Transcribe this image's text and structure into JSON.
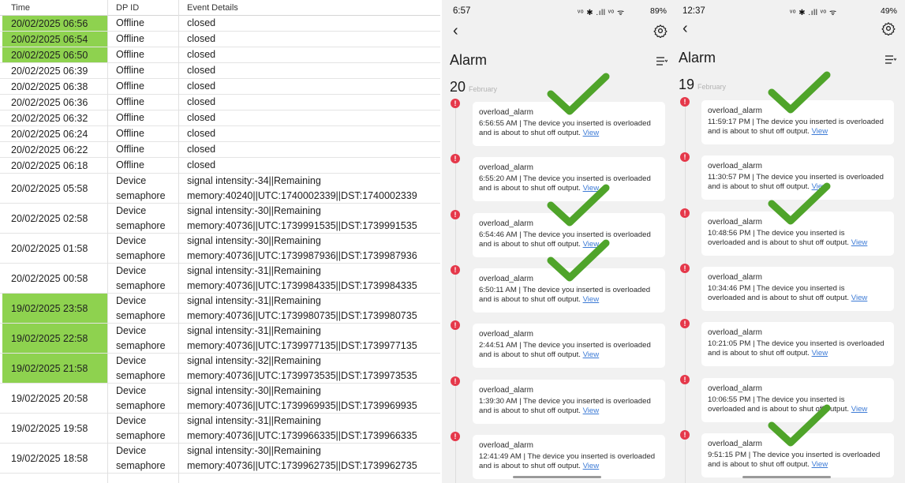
{
  "log": {
    "headers": [
      "Time",
      "DP ID",
      "Event Details"
    ],
    "rows": [
      {
        "time": "20/02/2025 06:56",
        "dp": "Offline",
        "ev1": "closed",
        "ev2": "",
        "hl": true
      },
      {
        "time": "20/02/2025 06:54",
        "dp": "Offline",
        "ev1": "closed",
        "ev2": "",
        "hl": true
      },
      {
        "time": "20/02/2025 06:50",
        "dp": "Offline",
        "ev1": "closed",
        "ev2": "",
        "hl": true
      },
      {
        "time": "20/02/2025 06:39",
        "dp": "Offline",
        "ev1": "closed",
        "ev2": "",
        "hl": false
      },
      {
        "time": "20/02/2025 06:38",
        "dp": "Offline",
        "ev1": "closed",
        "ev2": "",
        "hl": false
      },
      {
        "time": "20/02/2025 06:36",
        "dp": "Offline",
        "ev1": "closed",
        "ev2": "",
        "hl": false
      },
      {
        "time": "20/02/2025 06:32",
        "dp": "Offline",
        "ev1": "closed",
        "ev2": "",
        "hl": false
      },
      {
        "time": "20/02/2025 06:24",
        "dp": "Offline",
        "ev1": "closed",
        "ev2": "",
        "hl": false
      },
      {
        "time": "20/02/2025 06:22",
        "dp": "Offline",
        "ev1": "closed",
        "ev2": "",
        "hl": false
      },
      {
        "time": "20/02/2025 06:18",
        "dp": "Offline",
        "ev1": "closed",
        "ev2": "",
        "hl": false
      },
      {
        "time": "20/02/2025 05:58",
        "dp": "Device\nsemaphore",
        "ev1": "signal intensity:-34||Remaining",
        "ev2": "memory:40240||UTC:1740002339||DST:1740002339",
        "hl": false
      },
      {
        "time": "20/02/2025 02:58",
        "dp": "Device\nsemaphore",
        "ev1": "signal intensity:-30||Remaining",
        "ev2": "memory:40736||UTC:1739991535||DST:1739991535",
        "hl": false
      },
      {
        "time": "20/02/2025 01:58",
        "dp": "Device\nsemaphore",
        "ev1": "signal intensity:-30||Remaining",
        "ev2": "memory:40736||UTC:1739987936||DST:1739987936",
        "hl": false
      },
      {
        "time": "20/02/2025 00:58",
        "dp": "Device\nsemaphore",
        "ev1": "signal intensity:-31||Remaining",
        "ev2": "memory:40736||UTC:1739984335||DST:1739984335",
        "hl": false
      },
      {
        "time": "19/02/2025 23:58",
        "dp": "Device\nsemaphore",
        "ev1": "signal intensity:-31||Remaining",
        "ev2": "memory:40736||UTC:1739980735||DST:1739980735",
        "hl": true
      },
      {
        "time": "19/02/2025 22:58",
        "dp": "Device\nsemaphore",
        "ev1": "signal intensity:-31||Remaining",
        "ev2": "memory:40736||UTC:1739977135||DST:1739977135",
        "hl": true
      },
      {
        "time": "19/02/2025 21:58",
        "dp": "Device\nsemaphore",
        "ev1": "signal intensity:-32||Remaining",
        "ev2": "memory:40736||UTC:1739973535||DST:1739973535",
        "hl": true
      },
      {
        "time": "19/02/2025 20:58",
        "dp": "Device\nsemaphore",
        "ev1": "signal intensity:-30||Remaining",
        "ev2": "memory:40736||UTC:1739969935||DST:1739969935",
        "hl": false
      },
      {
        "time": "19/02/2025 19:58",
        "dp": "Device\nsemaphore",
        "ev1": "signal intensity:-31||Remaining",
        "ev2": "memory:40736||UTC:1739966335||DST:1739966335",
        "hl": false
      },
      {
        "time": "19/02/2025 18:58",
        "dp": "Device\nsemaphore",
        "ev1": "signal intensity:-30||Remaining",
        "ev2": "memory:40736||UTC:1739962735||DST:1739962735",
        "hl": false
      }
    ]
  },
  "phone1": {
    "clock": "6:57",
    "status_icons": "ᵛᵒ ✱ .ıll ᵛᵒ ᯤ",
    "battery": "89%",
    "title": "Alarm",
    "day": "20",
    "month": "February",
    "view_label": "View",
    "cards": [
      {
        "title": "overload_alarm",
        "line1": "6:56:55 AM | The device you inserted is overloaded",
        "line2": "and is about to shut off output.",
        "checked": true
      },
      {
        "title": "overload_alarm",
        "line1": "6:55:20 AM | The device you inserted is overloaded",
        "line2": "and is about to shut off output.",
        "checked": false
      },
      {
        "title": "overload_alarm",
        "line1": "6:54:46 AM | The device you inserted is overloaded",
        "line2": "and is about to shut off output.",
        "checked": true
      },
      {
        "title": "overload_alarm",
        "line1": "6:50:11 AM | The device you inserted is overloaded",
        "line2": "and is about to shut off output.",
        "checked": true
      },
      {
        "title": "overload_alarm",
        "line1": "2:44:51 AM | The device you inserted is overloaded",
        "line2": "and is about to shut off output.",
        "checked": false
      },
      {
        "title": "overload_alarm",
        "line1": "1:39:30 AM | The device you inserted is overloaded",
        "line2": "and is about to shut off output.",
        "checked": false
      },
      {
        "title": "overload_alarm",
        "line1": "12:41:49 AM | The device you inserted is overloaded",
        "line2": "and is about to shut off output.",
        "checked": false
      }
    ]
  },
  "phone2": {
    "clock": "12:37",
    "status_icons": "ᵛᵒ ✱ .ıll ᵛᵒ ᯤ",
    "battery": "49%",
    "title": "Alarm",
    "day": "19",
    "month": "February",
    "view_label": "View",
    "cards": [
      {
        "title": "overload_alarm",
        "line1": "11:59:17 PM | The device you inserted is overloaded",
        "line2": "and is about to shut off output.",
        "checked": true
      },
      {
        "title": "overload_alarm",
        "line1": "11:30:57 PM | The device you inserted is overloaded",
        "line2": "and is about to shut off output.",
        "checked": false
      },
      {
        "title": "overload_alarm",
        "line1": "10:48:56 PM | The device you inserted is",
        "line2": "overloaded and is about to shut off output.",
        "checked": true
      },
      {
        "title": "overload_alarm",
        "line1": "10:34:46 PM | The device you inserted is",
        "line2": "overloaded and is about to shut off output.",
        "checked": false
      },
      {
        "title": "overload_alarm",
        "line1": "10:21:05 PM | The device you inserted is overloaded",
        "line2": "and is about to shut off output.",
        "checked": false
      },
      {
        "title": "overload_alarm",
        "line1": "10:06:55 PM | The device you inserted is",
        "line2": "overloaded and is about to shut off output.",
        "checked": false
      },
      {
        "title": "overload_alarm",
        "line1": "9:51:15 PM | The device you inserted is overloaded",
        "line2": "and is about to shut off output.",
        "checked": true
      }
    ]
  },
  "colors": {
    "highlight": "#8ed24f",
    "checkmark": "#4fa42a",
    "alert": "#e5384a",
    "link": "#3d7bd6"
  }
}
